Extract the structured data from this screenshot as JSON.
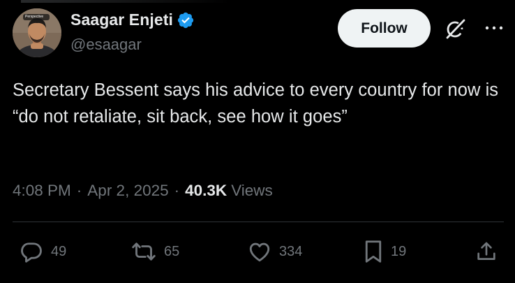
{
  "author": {
    "display_name": "Saagar Enjeti",
    "handle": "@esaagar",
    "verified": true,
    "avatar_badge_text": "Perspective"
  },
  "header": {
    "follow_label": "Follow"
  },
  "tweet": {
    "text": "Secretary Bessent says his advice to every country for now is “do not retaliate, sit back, see how it goes”",
    "time": "4:08 PM",
    "separator": "·",
    "date": "Apr 2, 2025",
    "views_count": "40.3K",
    "views_label": "Views"
  },
  "actions": {
    "replies": "49",
    "reposts": "65",
    "likes": "334",
    "bookmarks": "19"
  },
  "icons": {
    "reply": "reply-icon",
    "repost": "repost-icon",
    "like": "heart-icon",
    "bookmark": "bookmark-icon",
    "share": "share-icon",
    "grok": "grok-icon",
    "more": "more-icon",
    "verified": "verified-badge-icon"
  },
  "colors": {
    "background": "#000000",
    "text_primary": "#e7e9ea",
    "text_secondary": "#71767b",
    "verified_blue": "#1d9bf0",
    "follow_button_bg": "#eff3f4",
    "divider": "#2f3336"
  }
}
